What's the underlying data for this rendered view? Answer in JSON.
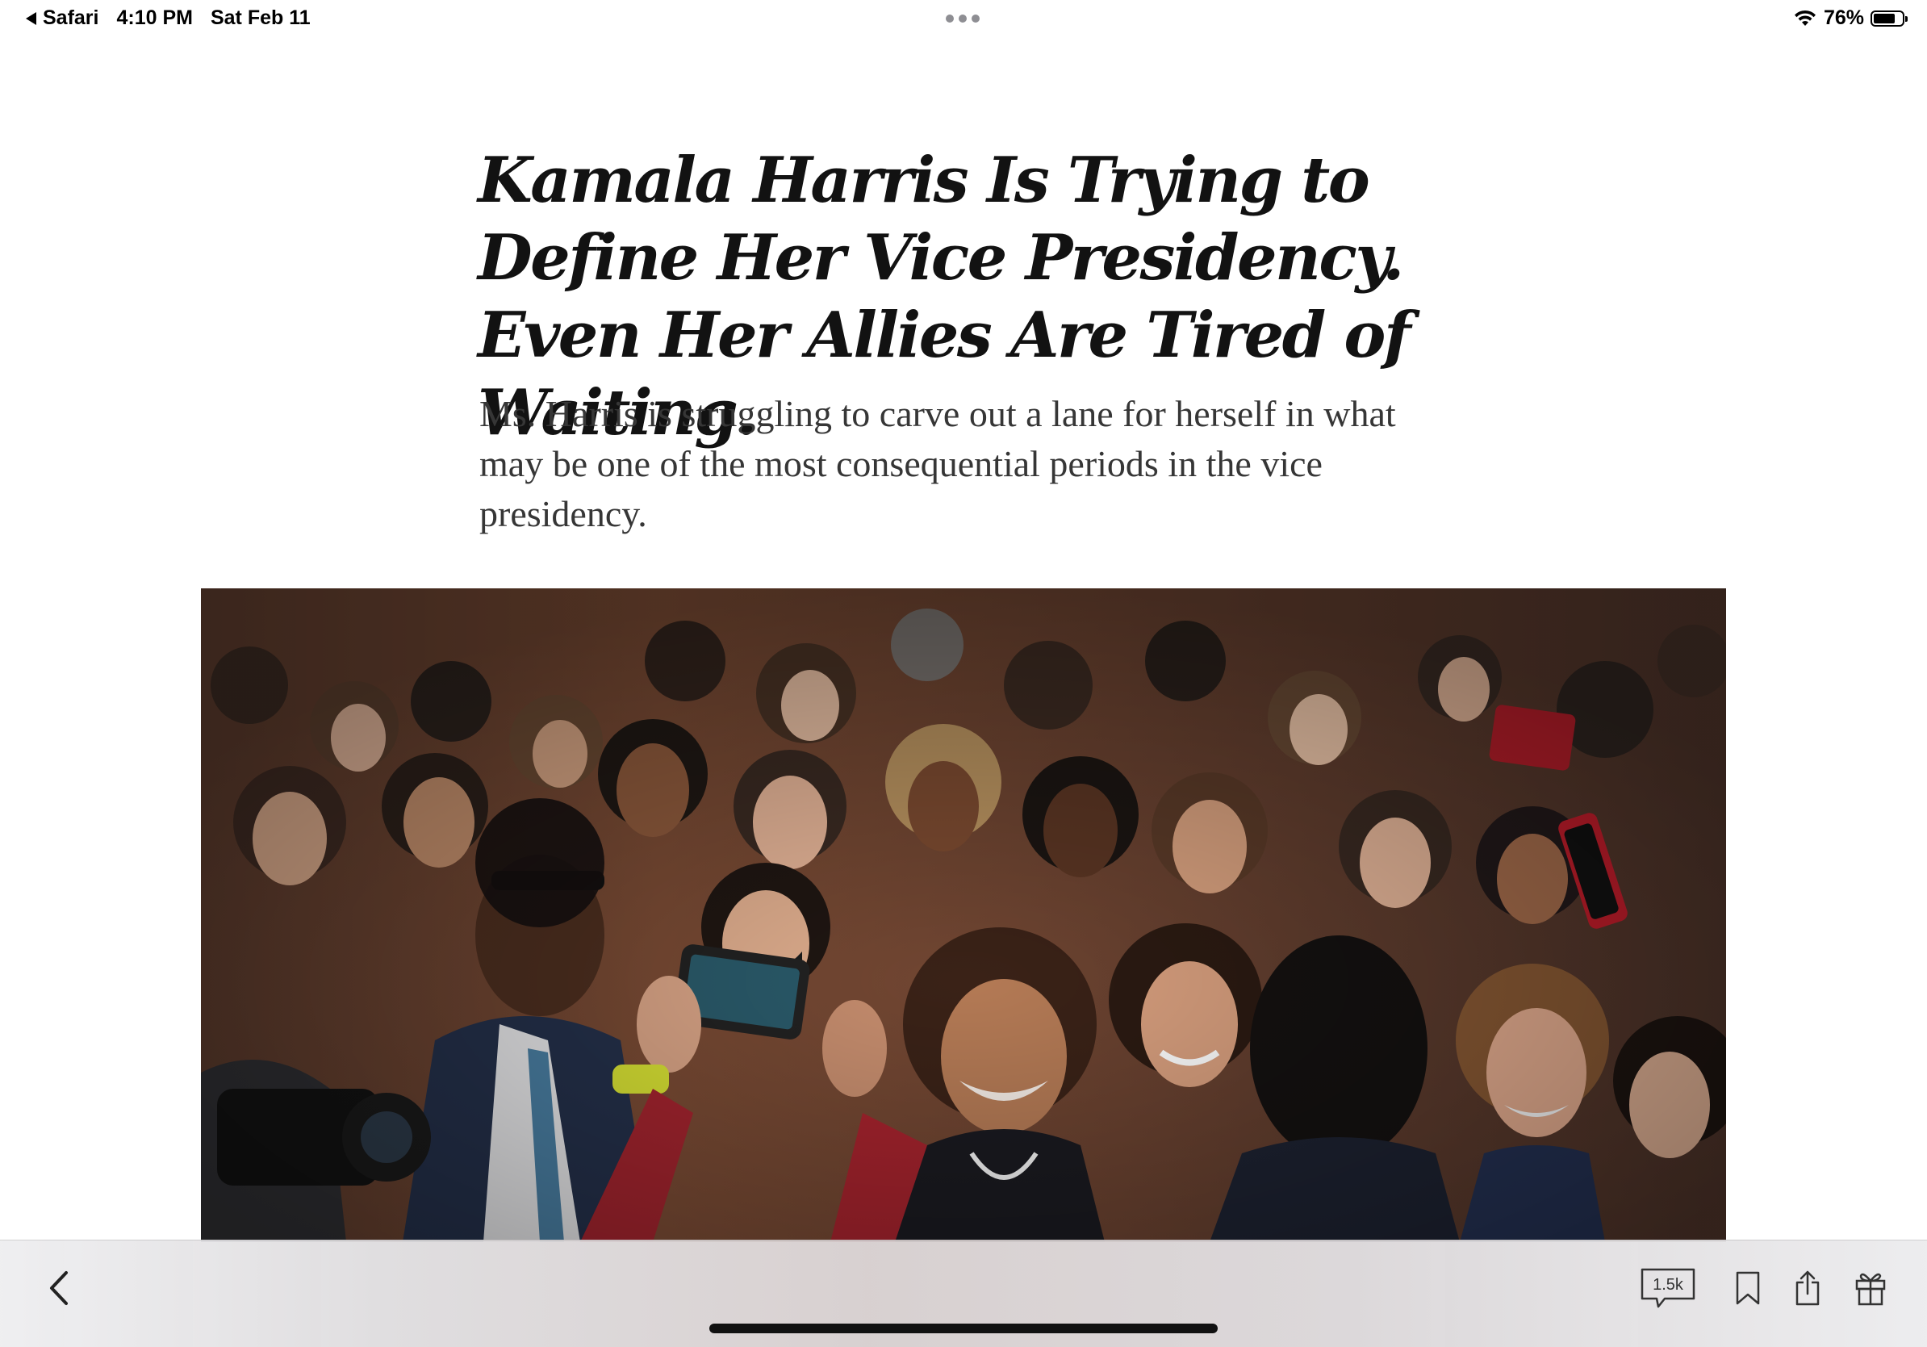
{
  "status_bar": {
    "back_app": "Safari",
    "time": "4:10 PM",
    "date": "Sat Feb 11",
    "battery_percent": "76%",
    "battery_level": 0.76
  },
  "article": {
    "headline": "Kamala Harris Is Trying to Define Her Vice Presidency. Even Her Allies Are Tired of Waiting.",
    "summary": "Ms. Harris is struggling to carve out a lane for herself in what may be one of the most consequential periods in the vice presidency."
  },
  "toolbar": {
    "comment_count": "1.5k",
    "icons": [
      "chevron-left-icon",
      "comment-icon",
      "bookmark-icon",
      "share-icon",
      "gift-icon"
    ]
  }
}
